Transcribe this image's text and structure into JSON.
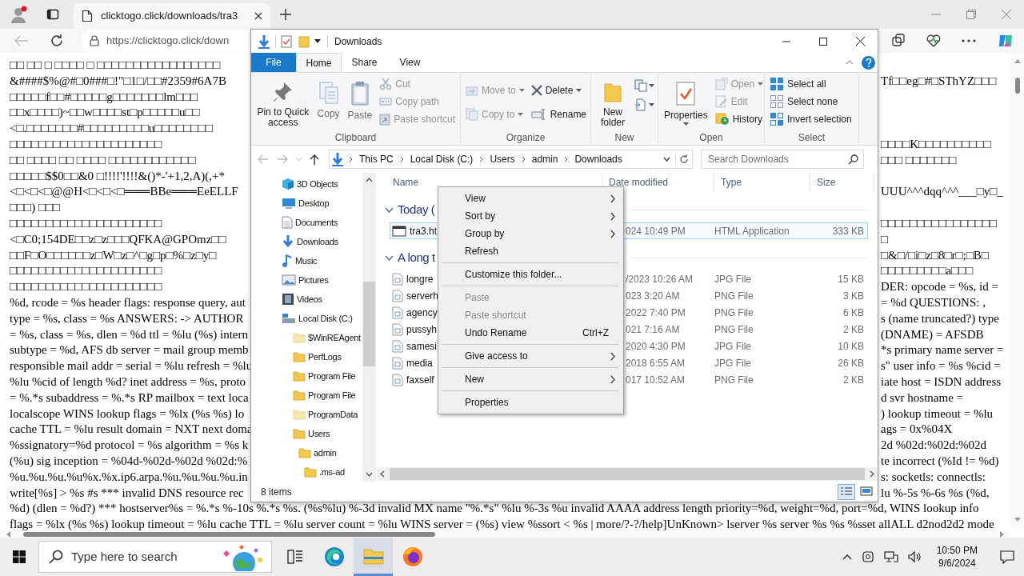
{
  "browser": {
    "tab": {
      "title": "clicktogo.click/downloads/tra3",
      "selected": true
    },
    "address": "https://clicktogo.click/down"
  },
  "page": {
    "lines": [
      {
        "left": "□□ □□ □ □□□□ □ □□□□□□□□□□□□□□□□□"
      },
      {
        "left": "&####$%@#□0###□!\"□1□/□□#2359#6A7B",
        "right": "Tf□□eg□#□SThYZ□□□"
      },
      {
        "left": "□□□□□f□□#□□□□□g□□□□□□□lm□□□"
      },
      {
        "left": "□□x□□□□)~□□w□□□□st□p□□□□□u□□"
      },
      {
        "left": "<□.□□□□□□□#□□□□□□□□□u□□□□□□□□"
      },
      {
        "left": "□□□□□□□□□□□□□□□□□□□□□",
        "right": "□□□□K□□□□□□□□□□"
      },
      {
        "left": "□□ □□□□ □□ □□□□ □□□□□□□□□□□□",
        "right": "□□□ □□□□□□□"
      },
      {
        "left": "□□□□□$$0□□&0 □!!!!'!!!!&()*-'+1,2,A)(,+*"
      },
      {
        "left": "<□<□<□@@H<□<□<□═══BBe═══EeELLF",
        "right": "UUU^^^dqq^^^___□y□_"
      },
      {
        "left": "□□□) □□□"
      },
      {
        "left": "□□□□□□□□□□□□□□□□□□□□□",
        "right": "□□□□□□□□□□□□□□□□"
      },
      {
        "left": "<□C0;154DE□□z□z□□□QFKA@GPOmz□□",
        "right": "□"
      },
      {
        "left": "□□F□O□□□□□□z□W□z□^□g□p□%□z□y□",
        "right": "□&□/□i□z□8□r□;□B□"
      },
      {
        "left": "□□□□□□□□□□□□□□□□□□□□□",
        "right": "□□□□□□□□□a□□□"
      },
      {
        "left": "□□□□□□□□□□□□□□□□□□□□□",
        "right": "DER: opcode = %s, id ="
      },
      {
        "left": "%d, rcode = %s header flags: response query, aut",
        "right": "= %d QUESTIONS: ,"
      },
      {
        "left": "type = %s, class = %s ANSWERS: -> AUTHOR",
        "right": "s (name truncated?) type"
      },
      {
        "left": "= %s, class = %s, dlen = %d ttl = %lu (%s) intern",
        "right": "(DNAME) = AFSDB"
      },
      {
        "left": "subtype = %d, AFS db server = mail group memb",
        "right": "*s primary name server ="
      },
      {
        "left": "responsible mail addr = serial = %lu refresh = %lu",
        "right": "s\" user info = %s %cid ="
      },
      {
        "left": "%lu %cid of length %d? inet address = %s, proto",
        "right": "iate host = ISDN address"
      },
      {
        "left": "= %.*s subaddress = %.*s RP mailbox = text loca",
        "right": "d svr hostname ="
      },
      {
        "left": "localscope WINS lookup flags = %lx (%s %s) lo",
        "right": ") lookup timeout = %lu"
      },
      {
        "left": "cache TTL = %lu result domain = NXT next doma",
        "right": "ags = 0x%04X"
      },
      {
        "left": "%ssignatory=%d protocol = %s algorithm = %s k",
        "right": "2d %02d:%02d:%02d"
      },
      {
        "left": "(%u) sig inception = %04d-%02d-%02d %02d:%",
        "right": "te incorrect (%Id != %d)"
      },
      {
        "left": "%u.%u.%u.%u%x.%x.ip6.arpa.%u.%u.%u.%u.in",
        "right": "s: socketls: connectls:"
      },
      {
        "left": "write[%s] > %s #s *** invalid DNS resource rec",
        "right": "lu %-5s %-6s %s (%d,"
      }
    ],
    "full_lines": [
      "%d) (dlen = %d?) *** hostserver%s = %.*s %-10s %.*s %s. (%s%lu) %-3d invalid MX name \"%.*s\" %lu %-3s %u invalid AAAA address length priority=%d, weight=%d, port=%d, WINS lookup info",
      "flags = %lx (%s %s) lookup timeout = %lu cache TTL = %lu server count = %lu WINS server = (%s) view %ssort < %s | more/?-?/help]UnKnown> lserver %s server %s %s %sset allALL d2nod2d2 mode"
    ]
  },
  "explorer": {
    "title": "Downloads",
    "ribbon_tabs": [
      {
        "label": "File",
        "kind": "file",
        "selected": false
      },
      {
        "label": "Home",
        "kind": "tab",
        "selected": true
      },
      {
        "label": "Share",
        "kind": "tab",
        "selected": false
      },
      {
        "label": "View",
        "kind": "tab",
        "selected": false
      }
    ],
    "ribbon_groups": [
      {
        "label": "Clipboard",
        "blocks": [
          {
            "kind": "large",
            "label": "Pin to Quick access",
            "disabled": false
          },
          {
            "kind": "large",
            "label": "Copy",
            "disabled": true
          },
          {
            "kind": "large",
            "label": "Paste",
            "disabled": true
          },
          {
            "kind": "stack",
            "items": [
              {
                "label": "Cut",
                "disabled": true
              },
              {
                "label": "Copy path",
                "disabled": true
              },
              {
                "label": "Paste shortcut",
                "disabled": true
              }
            ]
          }
        ]
      },
      {
        "label": "Organize",
        "blocks": [
          {
            "kind": "stack",
            "items": [
              {
                "label": "Move to",
                "disabled": true,
                "dropdown": true
              },
              {
                "label": "Copy to",
                "disabled": true,
                "dropdown": true
              }
            ]
          },
          {
            "kind": "stack",
            "items": [
              {
                "label": "Delete",
                "disabled": false,
                "dropdown": true
              },
              {
                "label": "Rename",
                "disabled": false
              }
            ]
          }
        ]
      },
      {
        "label": "New",
        "blocks": [
          {
            "kind": "large",
            "label": "New folder",
            "disabled": false
          },
          {
            "kind": "icons"
          }
        ]
      },
      {
        "label": "Open",
        "blocks": [
          {
            "kind": "large",
            "label": "Properties",
            "disabled": false,
            "dropdown": true
          },
          {
            "kind": "stack",
            "items": [
              {
                "label": "Open",
                "disabled": true,
                "dropdown": true
              },
              {
                "label": "Edit",
                "disabled": true
              },
              {
                "label": "History",
                "disabled": false
              }
            ]
          }
        ]
      },
      {
        "label": "Select",
        "blocks": [
          {
            "kind": "stack",
            "items": [
              {
                "label": "Select all",
                "disabled": false
              },
              {
                "label": "Select none",
                "disabled": false
              },
              {
                "label": "Invert selection",
                "disabled": false
              }
            ]
          }
        ]
      }
    ],
    "breadcrumbs": [
      "This PC",
      "Local Disk (C:)",
      "Users",
      "admin",
      "Downloads"
    ],
    "search": {
      "placeholder": "Search Downloads"
    },
    "nav": [
      {
        "label": "3D Objects"
      },
      {
        "label": "Desktop"
      },
      {
        "label": "Documents"
      },
      {
        "label": "Downloads"
      },
      {
        "label": "Music"
      },
      {
        "label": "Pictures"
      },
      {
        "label": "Videos"
      },
      {
        "label": "Local Disk (C:)",
        "children": [
          {
            "label": "$WinREAgent",
            "hidden": true
          },
          {
            "label": "PerfLogs",
            "hidden": false
          },
          {
            "label": "Program File",
            "hidden": false
          },
          {
            "label": "Program File",
            "hidden": false
          },
          {
            "label": "ProgramData",
            "hidden": true
          },
          {
            "label": "Users",
            "hidden": false,
            "children": [
              {
                "label": "admin",
                "hidden": false,
                "children": [
                  {
                    "label": ".ms-ad",
                    "hidden": false
                  }
                ]
              }
            ]
          }
        ]
      }
    ],
    "columns": [
      "Name",
      "Date modified",
      "Type",
      "Size"
    ],
    "groups": [
      {
        "label": "Today (",
        "files": [
          {
            "name": "tra3.ht",
            "kind": "app",
            "date": "024 10:49 PM",
            "type": "HTML Application",
            "size": "333 KB",
            "selected": true
          }
        ]
      },
      {
        "label": "A long t",
        "files": [
          {
            "name": "longre",
            "kind": "image",
            "date": "/2023 10:26 AM",
            "type": "JPG File",
            "size": "15 KB",
            "selected": false
          },
          {
            "name": "serverh",
            "kind": "image",
            "date": "023 3:20 AM",
            "type": "PNG File",
            "size": "3 KB",
            "selected": false
          },
          {
            "name": "agency",
            "kind": "image",
            "date": "2022 7:40 PM",
            "type": "PNG File",
            "size": "6 KB",
            "selected": false
          },
          {
            "name": "pussyh",
            "kind": "image",
            "date": "021 7:16 AM",
            "type": "PNG File",
            "size": "2 KB",
            "selected": false
          },
          {
            "name": "samesi",
            "kind": "image",
            "date": "2020 4:30 PM",
            "type": "JPG File",
            "size": "10 KB",
            "selected": false
          },
          {
            "name": "media",
            "kind": "image",
            "date": "2018 6:55 AM",
            "type": "JPG File",
            "size": "26 KB",
            "selected": false
          },
          {
            "name": "faxself",
            "kind": "image",
            "date": "017 10:52 AM",
            "type": "PNG File",
            "size": "2 KB",
            "selected": false
          }
        ]
      }
    ],
    "status": "8 items",
    "context_menu": [
      {
        "kind": "item",
        "label": "View",
        "submenu": true,
        "disabled": false
      },
      {
        "kind": "item",
        "label": "Sort by",
        "submenu": true,
        "disabled": false
      },
      {
        "kind": "item",
        "label": "Group by",
        "submenu": true,
        "disabled": false
      },
      {
        "kind": "item",
        "label": "Refresh",
        "disabled": false
      },
      {
        "kind": "separator"
      },
      {
        "kind": "item",
        "label": "Customize this folder...",
        "disabled": false
      },
      {
        "kind": "separator"
      },
      {
        "kind": "item",
        "label": "Paste",
        "disabled": true
      },
      {
        "kind": "item",
        "label": "Paste shortcut",
        "disabled": true
      },
      {
        "kind": "item",
        "label": "Undo Rename",
        "shortcut": "Ctrl+Z",
        "disabled": false
      },
      {
        "kind": "separator"
      },
      {
        "kind": "item",
        "label": "Give access to",
        "submenu": true,
        "disabled": false
      },
      {
        "kind": "separator"
      },
      {
        "kind": "item",
        "label": "New",
        "submenu": true,
        "disabled": false
      },
      {
        "kind": "separator"
      },
      {
        "kind": "item",
        "label": "Properties",
        "disabled": false
      }
    ]
  },
  "taskbar": {
    "search": {
      "placeholder": "Type here to search"
    },
    "apps": [
      {
        "kind": "taskview",
        "active": false
      },
      {
        "kind": "edge",
        "active": false
      },
      {
        "kind": "explorer",
        "active": true
      },
      {
        "kind": "firefox",
        "active": false
      }
    ],
    "time": "10:50 PM",
    "date": "9/6/2024"
  }
}
